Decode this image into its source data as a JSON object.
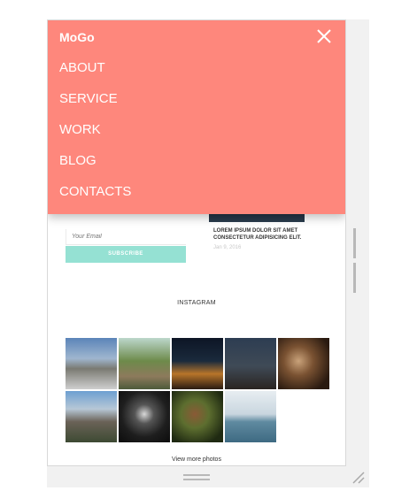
{
  "menu": {
    "brand": "MoGo",
    "items": [
      {
        "label": "ABOUT"
      },
      {
        "label": "SERVICE"
      },
      {
        "label": "WORK"
      },
      {
        "label": "BLOG"
      },
      {
        "label": "CONTACTS"
      }
    ],
    "close_icon": "close-icon"
  },
  "post": {
    "title": "LOREM IPSUM DOLOR SIT AMET CONSECTETUR ADIPISICING ELIT.",
    "date": "Jan 9, 2016"
  },
  "newsletter": {
    "email_placeholder": "Your Email",
    "subscribe_label": "SUBSCRIBE"
  },
  "instagram": {
    "heading": "INSTAGRAM",
    "view_more": "View more photos"
  },
  "colors": {
    "menu_bg": "#fe877c",
    "accent_teal": "#95e1d3"
  }
}
